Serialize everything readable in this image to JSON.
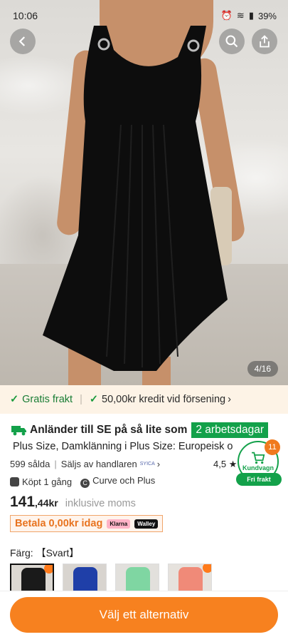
{
  "status_bar": {
    "time": "10:06",
    "battery": "39%"
  },
  "gallery": {
    "counter": "4/16"
  },
  "shipping_bar": {
    "free_shipping": "Gratis frakt",
    "credit": "50,00kr kredit vid försening"
  },
  "delivery": {
    "text": "Anländer till SE på så lite som",
    "badge": "2 arbetsdagar"
  },
  "product": {
    "title": "Plus Size, Damklänning i Plus Size: Europeisk o",
    "sold": "599 sålda",
    "seller": "Säljs av handlaren",
    "seller_brand": "SYICA",
    "rating": "4,5",
    "bought": "Köpt 1 gång",
    "brand": "Curve och Plus"
  },
  "price": {
    "main": "141",
    "decimals": ",44kr",
    "tax_note": "inklusive moms"
  },
  "payment": {
    "text": "Betala 0,00kr idag",
    "provider1": "Klarna",
    "provider2": "Walley"
  },
  "color": {
    "label": "Färg: 【Svart】"
  },
  "swatches": [
    {
      "name": "Svart",
      "color": "#1a1a1a",
      "bg": "#dcd8d2"
    },
    {
      "name": "Blå",
      "color": "#1f3fa8",
      "bg": "#d8d4cf"
    },
    {
      "name": "Grön",
      "color": "#7fd6a2",
      "bg": "#e2e0dc"
    },
    {
      "name": "Korall",
      "color": "#f08a78",
      "bg": "#e6e2dd"
    }
  ],
  "cart": {
    "count": "11",
    "label": "Kundvagn",
    "free_shipping": "Fri frakt"
  },
  "cta": {
    "label": "Välj ett alternativ"
  },
  "colors": {
    "accent": "#f7811f",
    "green": "#13a14a"
  }
}
